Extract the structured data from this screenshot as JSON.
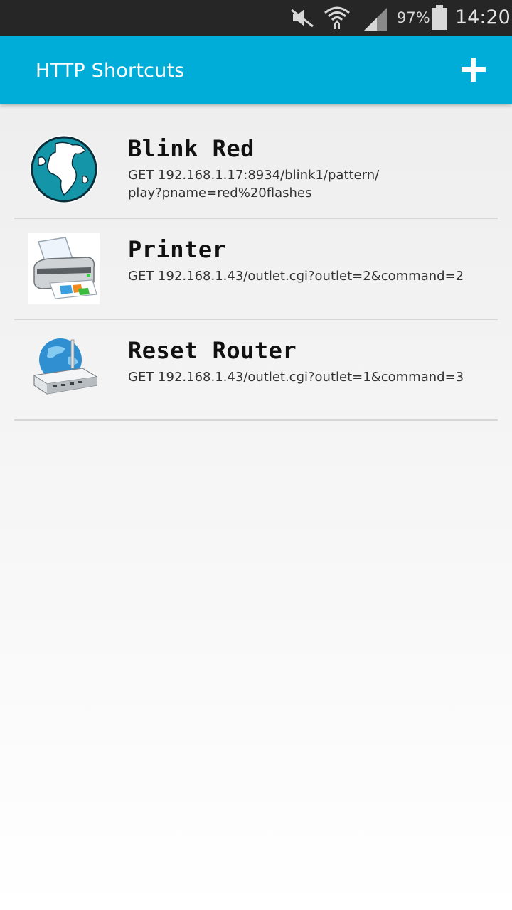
{
  "status_bar": {
    "battery_percent": "97%",
    "time": "14:20",
    "icons": [
      "mute-icon",
      "wifi-icon",
      "signal-icon",
      "battery-icon"
    ]
  },
  "app_bar": {
    "title": "HTTP Shortcuts",
    "add_icon": "plus-icon",
    "color": "#00acd8"
  },
  "shortcuts": [
    {
      "name": "Blink Red",
      "url_line1": "GET 192.168.1.17:8934/blink1/pattern/",
      "url_line2": "play?pname=red%20flashes",
      "icon": "globe-icon"
    },
    {
      "name": "Printer",
      "url_line1": "GET 192.168.1.43/outlet.cgi?outlet=2&command=2",
      "icon": "printer-icon"
    },
    {
      "name": "Reset Router",
      "url_line1": "GET 192.168.1.43/outlet.cgi?outlet=1&command=3",
      "icon": "router-icon"
    }
  ]
}
